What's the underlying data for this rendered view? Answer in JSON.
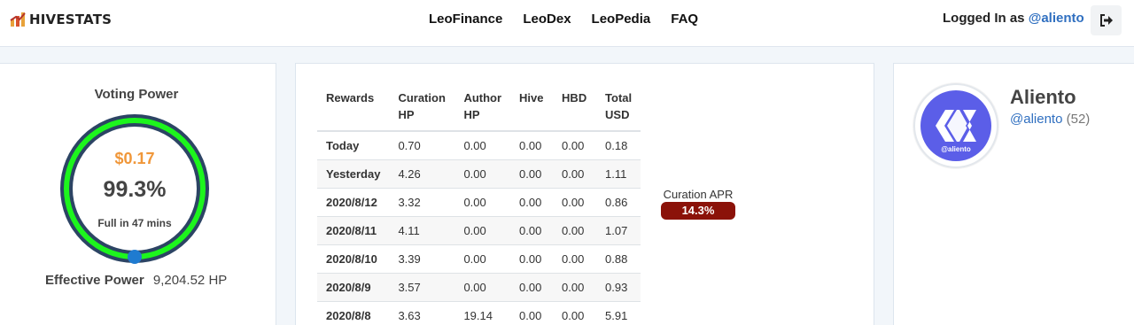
{
  "brand": {
    "name": "HIVESTATS",
    "icon": "bar-chart-icon"
  },
  "nav": {
    "links": [
      "LeoFinance",
      "LeoDex",
      "LeoPedia",
      "FAQ"
    ]
  },
  "login": {
    "prefix": "Logged In as",
    "user": "@aliento",
    "logout_icon": "sign-out-icon"
  },
  "voting_power": {
    "title": "Voting Power",
    "amount": "$0.17",
    "percent": "99.3%",
    "percent_value": 99.3,
    "full_in": "Full in 47 mins",
    "effective_label": "Effective Power",
    "effective_value": "9,204.52 HP",
    "colors": {
      "ring_outer": "#2c4464",
      "ring_progress": "#1df51d",
      "knob": "#1f7bd0",
      "amount": "#f0973a"
    }
  },
  "rewards": {
    "headers": [
      [
        "Rewards"
      ],
      [
        "Curation",
        "HP"
      ],
      [
        "Author",
        "HP"
      ],
      [
        "Hive"
      ],
      [
        "HBD"
      ],
      [
        "Total",
        "USD"
      ]
    ],
    "rows": [
      [
        "Today",
        "0.70",
        "0.00",
        "0.00",
        "0.00",
        "0.18"
      ],
      [
        "Yesterday",
        "4.26",
        "0.00",
        "0.00",
        "0.00",
        "1.11"
      ],
      [
        "2020/8/12",
        "3.32",
        "0.00",
        "0.00",
        "0.00",
        "0.86"
      ],
      [
        "2020/8/11",
        "4.11",
        "0.00",
        "0.00",
        "0.00",
        "1.07"
      ],
      [
        "2020/8/10",
        "3.39",
        "0.00",
        "0.00",
        "0.00",
        "0.88"
      ],
      [
        "2020/8/9",
        "3.57",
        "0.00",
        "0.00",
        "0.00",
        "0.93"
      ],
      [
        "2020/8/8",
        "3.63",
        "19.14",
        "0.00",
        "0.00",
        "5.91"
      ]
    ],
    "apr_label": "Curation APR",
    "apr_value": "14.3%",
    "apr_color": "#8b1209"
  },
  "profile": {
    "name": "Aliento",
    "handle": "@aliento",
    "reputation": "(52)",
    "avatar_caption": "@aliento",
    "avatar_color": "#5b5ee8"
  }
}
